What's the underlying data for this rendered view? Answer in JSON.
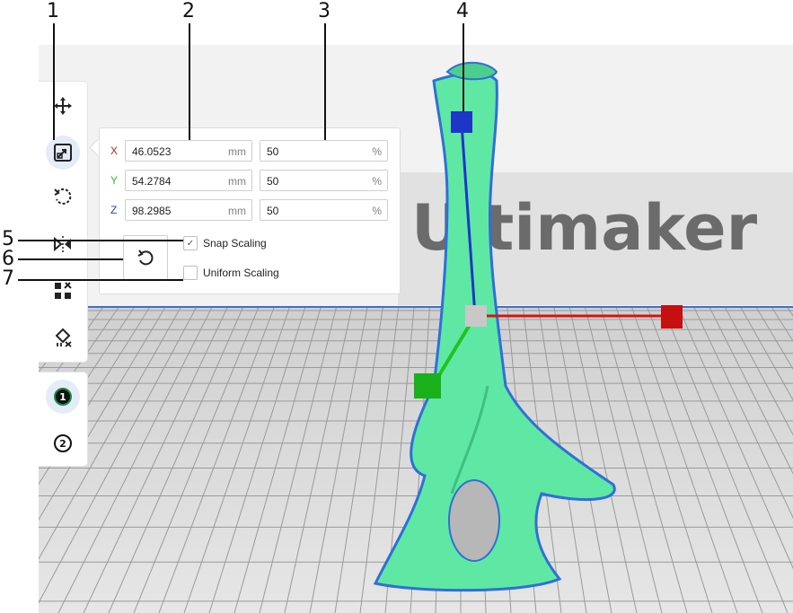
{
  "callouts": [
    "1",
    "2",
    "3",
    "4",
    "5",
    "6",
    "7"
  ],
  "scene": {
    "brand_text": "Ultimaker"
  },
  "toolbar": {
    "tools": [
      {
        "name": "move-tool",
        "icon": "move-icon"
      },
      {
        "name": "scale-tool",
        "icon": "scale-icon",
        "active": true
      },
      {
        "name": "rotate-tool",
        "icon": "rotate-icon"
      },
      {
        "name": "mirror-tool",
        "icon": "mirror-icon"
      },
      {
        "name": "per-model-settings-tool",
        "icon": "per-model-settings-icon"
      },
      {
        "name": "support-blocker-tool",
        "icon": "support-blocker-icon"
      }
    ],
    "extruders": [
      {
        "label": "1",
        "active": true
      },
      {
        "label": "2"
      }
    ]
  },
  "scale_panel": {
    "rows": [
      {
        "axis": "X",
        "color": "#d11f1f",
        "size": "46.0523",
        "size_unit": "mm",
        "percent": "50",
        "percent_unit": "%"
      },
      {
        "axis": "Y",
        "color": "#2fbf2f",
        "size": "54.2784",
        "size_unit": "mm",
        "percent": "50",
        "percent_unit": "%"
      },
      {
        "axis": "Z",
        "color": "#2045d8",
        "size": "98.2985",
        "size_unit": "mm",
        "percent": "50",
        "percent_unit": "%"
      }
    ],
    "snap_scaling": {
      "label": "Snap Scaling",
      "checked": true
    },
    "uniform_scaling": {
      "label": "Uniform Scaling",
      "checked": false
    }
  },
  "colors": {
    "model": "#5fe8a4",
    "model_outline": "#2f6fd6",
    "accent": "#3a6fd6"
  }
}
